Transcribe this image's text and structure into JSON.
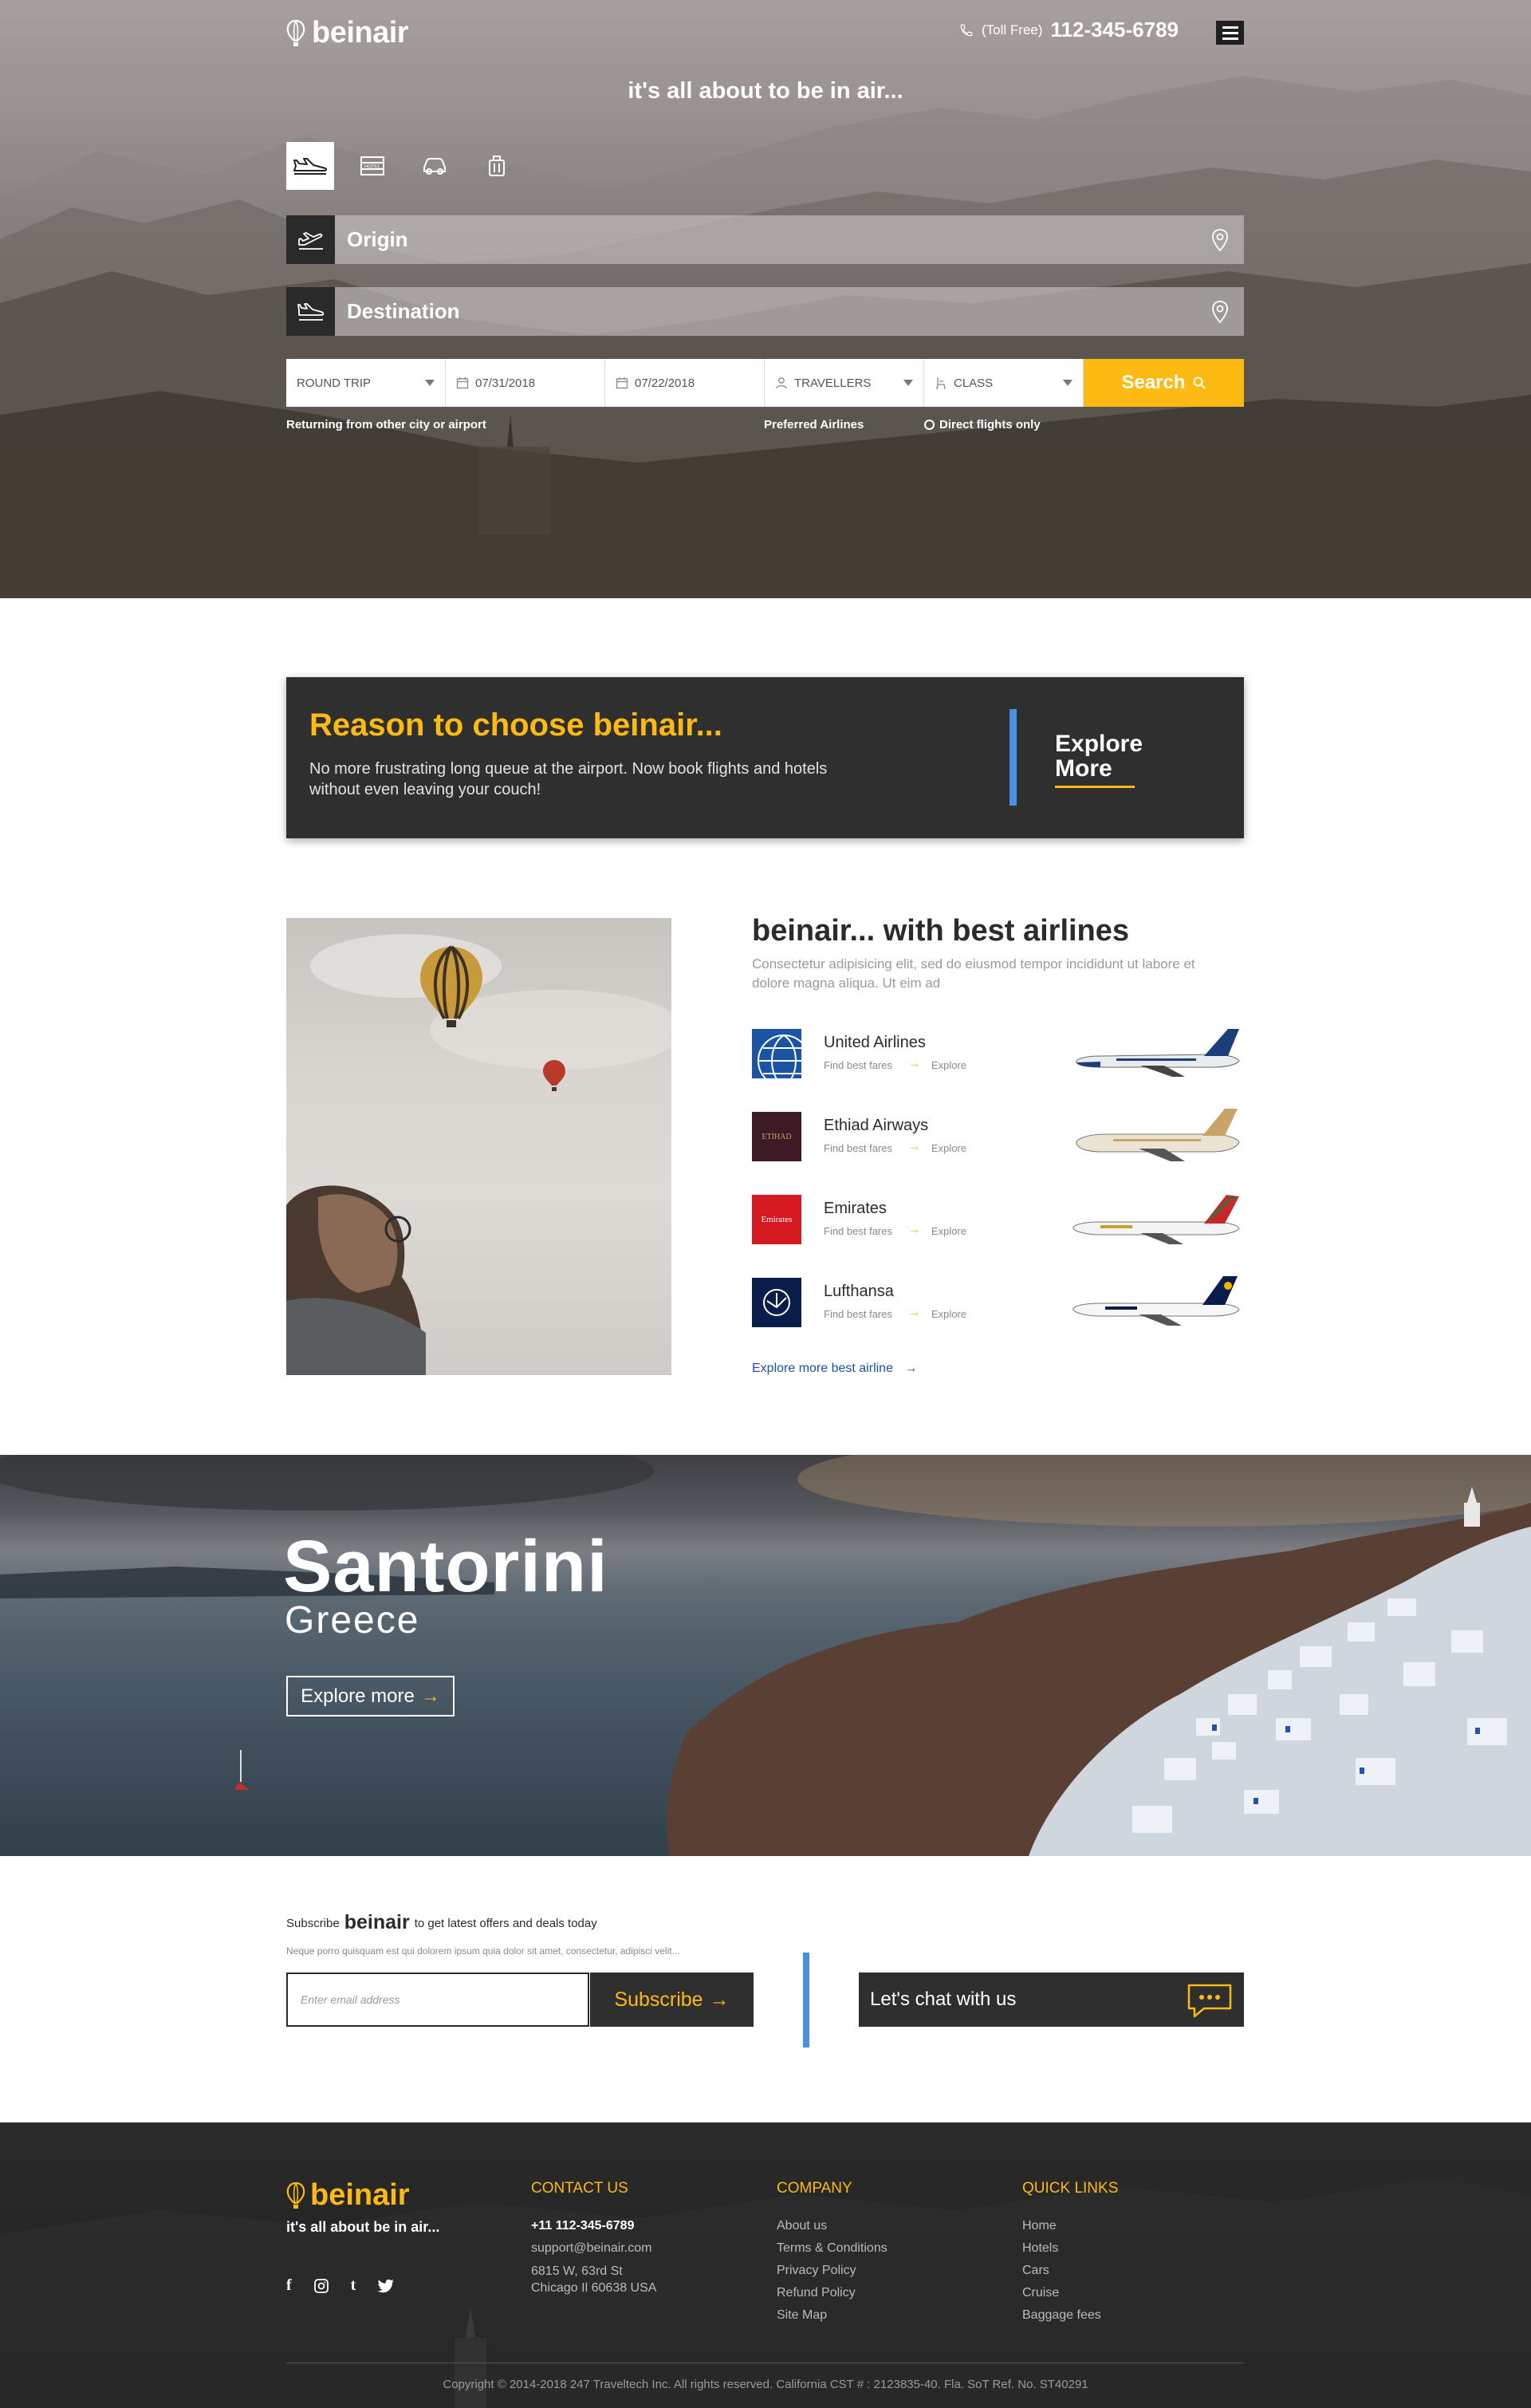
{
  "header": {
    "logo_text": "beinair",
    "toll_free_label": "(Toll Free)",
    "phone": "112-345-6789",
    "tagline": "it's all about to be in air..."
  },
  "search": {
    "modes": [
      {
        "icon": "flight-icon",
        "active": true
      },
      {
        "icon": "hotel-icon",
        "active": false
      },
      {
        "icon": "car-icon",
        "active": false
      },
      {
        "icon": "luggage-icon",
        "active": false
      }
    ],
    "origin": "Origin",
    "destination": "Destination",
    "trip_type": "ROUND TRIP",
    "depart_date": "07/31/2018",
    "return_date": "07/22/2018",
    "travellers": "TRAVELLERS",
    "class": "CLASS",
    "search_label": "Search",
    "returning_link": "Returning from other city or airport",
    "preferred_airlines": "Preferred Airlines",
    "direct_only": "Direct flights only"
  },
  "reason": {
    "title": "Reason to choose beinair...",
    "description": "No more frustrating long queue at the airport. Now book flights and hotels without even leaving your couch!",
    "explore_line1": "Explore",
    "explore_line2": "More"
  },
  "airlines": {
    "title": "beinair... with best airlines",
    "description": "Consectetur adipisicing elit, sed do eiusmod tempor incididunt ut labore et dolore magna aliqua. Ut eim ad",
    "find_label": "Find best fares",
    "explore_label": "Explore",
    "items": [
      {
        "name": "United Airlines"
      },
      {
        "name": "Ethiad Airways",
        "logo_text": "ETIHAD"
      },
      {
        "name": "Emirates",
        "logo_text": "Emirates"
      },
      {
        "name": "Lufthansa"
      }
    ],
    "more_link": "Explore more best airline"
  },
  "destination": {
    "city": "Santorini",
    "country": "Greece",
    "button": "Explore more"
  },
  "subscribe": {
    "prefix": "Subscribe",
    "brand": "beinair",
    "suffix": "to get  latest offers and deals today",
    "description": "Neque porro quisquam est qui dolorem ipsum quia dolor sit amet, consectetur, adipisci velit...",
    "email_placeholder": "Enter email address",
    "button": "Subscribe",
    "chat_label": "Let's chat with us"
  },
  "footer": {
    "logo_text": "beinair",
    "tagline": "it's all about be in air...",
    "contact": {
      "heading": "CONTACT US",
      "phone": "+11 112-345-6789",
      "email": "support@beinair.com",
      "address1": "6815 W, 63rd St",
      "address2": "Chicago Il 60638 USA"
    },
    "company": {
      "heading": "COMPANY",
      "links": [
        "About us",
        "Terms & Conditions",
        "Privacy Policy",
        "Refund Policy",
        "Site Map"
      ]
    },
    "quick": {
      "heading": "QUICK LINKS",
      "links": [
        "Home",
        "Hotels",
        "Cars",
        "Cruise",
        "Baggage fees"
      ]
    },
    "copyright": "Copyright © 2014-2018 247 Traveltech Inc. All rights reserved. California CST # : 2123835-40. Fla. SoT Ref. No. ST40291"
  },
  "colors": {
    "accent": "#fdba12",
    "dark": "#2f2f2f",
    "blue_bar": "#4a90e2",
    "link_blue": "#1e4fa3"
  }
}
